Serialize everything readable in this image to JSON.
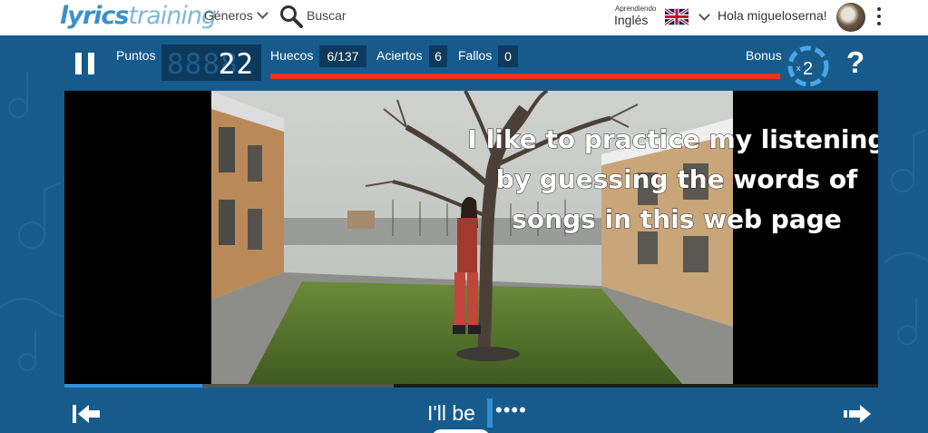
{
  "header": {
    "logo_main": "lyrics",
    "logo_sub": "training",
    "nav_genres": "Géneros",
    "nav_search": "Buscar",
    "learning_small": "Aprendiendo",
    "learning_language": "Inglés",
    "greeting": "Hola migueloserna!",
    "icons": [
      "search-icon",
      "uk-flag-icon",
      "chevron-down-icon",
      "avatar",
      "kebab-menu-icon"
    ]
  },
  "game": {
    "points_label": "Puntos",
    "points_ghost": "8888",
    "points_value": "22",
    "gaps_label": "Huecos",
    "gaps_value": "6/137",
    "hits_label": "Aciertos",
    "hits_value": "6",
    "misses_label": "Fallos",
    "misses_value": "0",
    "bonus_label": "Bonus",
    "bonus_prefix": "x",
    "bonus_value": "2",
    "help_label": "?",
    "progress_fraction": 0.17
  },
  "video": {
    "subtitle_lines": [
      "I like to practice my listening",
      "by guessing the words of",
      "songs in this web page"
    ]
  },
  "lyrics": {
    "current_text": "I'll be",
    "pending_gap": "••••"
  },
  "colors": {
    "game_bg": "#175b8d",
    "accent_red": "#e8322b",
    "accent_blue": "#2f8fd8"
  }
}
